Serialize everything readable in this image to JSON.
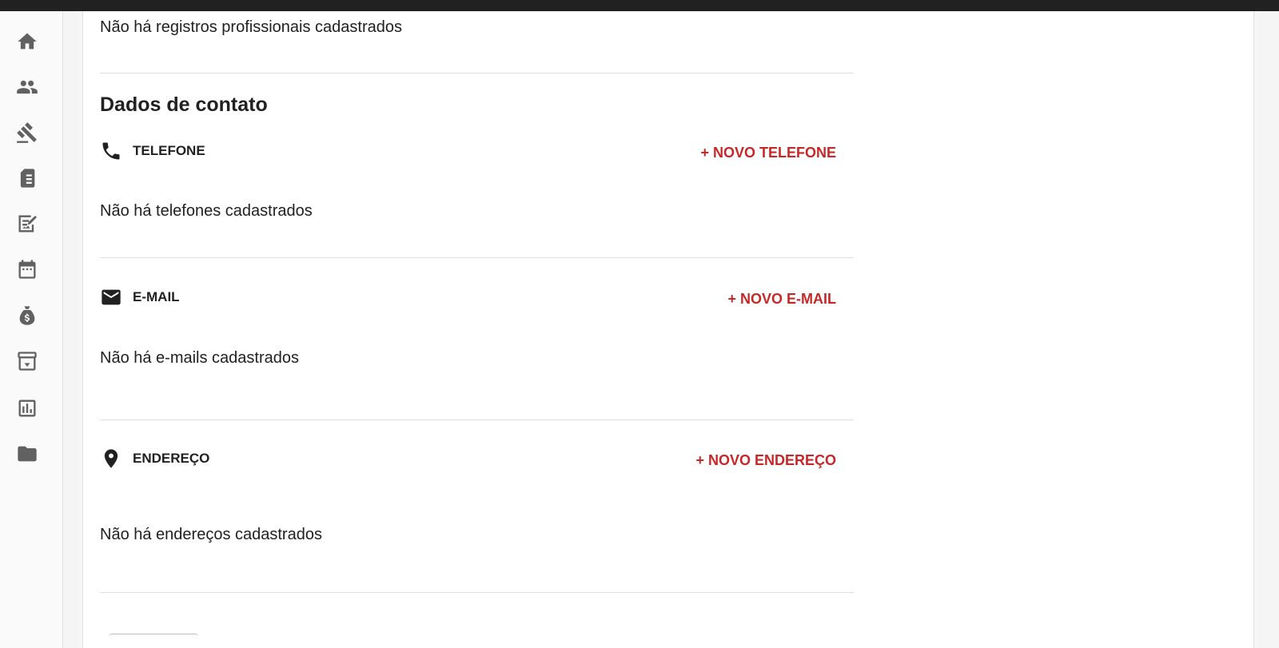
{
  "sidebar": {
    "items": [
      {
        "icon": "home-icon"
      },
      {
        "icon": "people-icon"
      },
      {
        "icon": "gavel-icon"
      },
      {
        "icon": "book-icon"
      },
      {
        "icon": "edit-document-icon"
      },
      {
        "icon": "calendar-icon"
      },
      {
        "icon": "money-bag-icon"
      },
      {
        "icon": "archive-icon"
      },
      {
        "icon": "chart-icon"
      },
      {
        "icon": "folder-icon"
      }
    ]
  },
  "professional": {
    "empty_text": "Não há registros profissionais cadastrados"
  },
  "contact": {
    "title": "Dados de contato",
    "phone": {
      "label": "TELEFONE",
      "action": "+ NOVO TELEFONE",
      "empty_text": "Não há telefones cadastrados"
    },
    "email": {
      "label": "E-MAIL",
      "action": "+ NOVO E-MAIL",
      "empty_text": "Não há e-mails cadastrados"
    },
    "address": {
      "label": "ENDEREÇO",
      "action": "+ NOVO ENDEREÇO",
      "empty_text": "Não há endereços cadastrados"
    }
  },
  "colors": {
    "accent": "#c62828",
    "icon_gray": "#616161",
    "topbar": "#212121"
  }
}
